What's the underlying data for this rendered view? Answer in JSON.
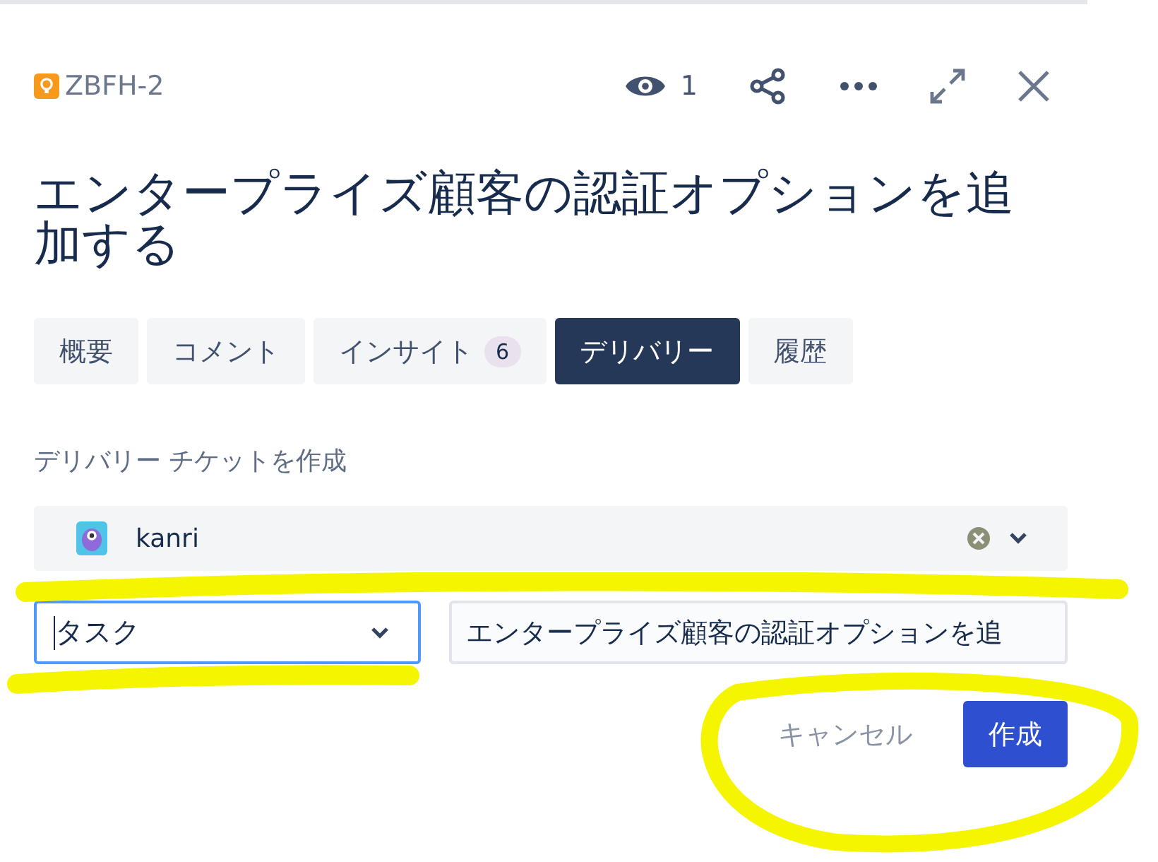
{
  "issue": {
    "key": "ZBFH-2",
    "title": "エンタープライズ顧客の認証オプションを追加する"
  },
  "toolbar": {
    "watchers": "1"
  },
  "tabs": [
    {
      "label": "概要",
      "selected": false
    },
    {
      "label": "コメント",
      "selected": false
    },
    {
      "label": "インサイト",
      "badge": "6",
      "selected": false
    },
    {
      "label": "デリバリー",
      "selected": true
    },
    {
      "label": "履歴",
      "selected": false
    }
  ],
  "delivery": {
    "heading": "デリバリー チケットを作成",
    "project": "kanri",
    "issue_type": "タスク",
    "summary": "エンタープライズ顧客の認証オプションを追",
    "buttons": [
      {
        "label": "キャンセル",
        "kind": "subtle"
      },
      {
        "label": "作成",
        "kind": "primary"
      }
    ]
  }
}
